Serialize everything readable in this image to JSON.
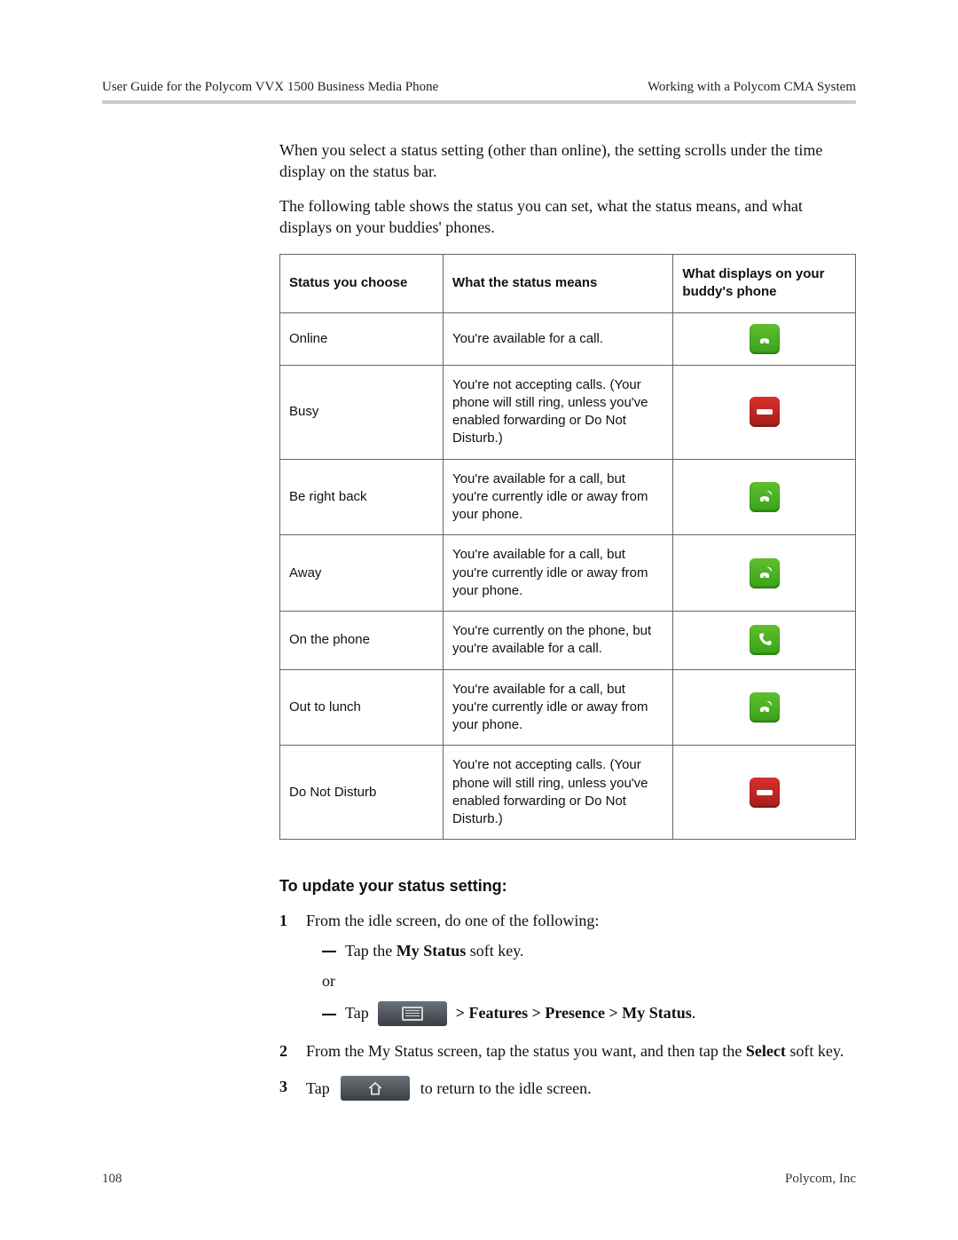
{
  "header": {
    "left": "User Guide for the Polycom VVX 1500 Business Media Phone",
    "right": "Working with a Polycom CMA System"
  },
  "intro": {
    "p1": "When you select a status setting (other than online), the setting scrolls under the time display on the status bar.",
    "p2": "The following table shows the status you can set, what the status means, and what displays on your buddies' phones."
  },
  "table": {
    "headers": {
      "c1": "Status you choose",
      "c2": "What the status means",
      "c3": "What displays on your buddy's phone"
    },
    "rows": [
      {
        "status": "Online",
        "meaning": "You're available for a call.",
        "icon": "online"
      },
      {
        "status": "Busy",
        "meaning": "You're not accepting calls. (Your phone will still ring, unless you've enabled forwarding or Do Not Disturb.)",
        "icon": "busy"
      },
      {
        "status": "Be right back",
        "meaning": "You're available for a call, but you're currently idle or away from your phone.",
        "icon": "away"
      },
      {
        "status": "Away",
        "meaning": "You're available for a call, but you're currently idle or away from your phone.",
        "icon": "away"
      },
      {
        "status": "On the phone",
        "meaning": "You're currently on the phone, but you're available for a call.",
        "icon": "onphone"
      },
      {
        "status": "Out to lunch",
        "meaning": "You're available for a call, but you're currently idle or away from your phone.",
        "icon": "away"
      },
      {
        "status": "Do Not Disturb",
        "meaning": "You're not accepting calls. (Your phone will still ring, unless you've enabled forwarding or Do Not Disturb.)",
        "icon": "busy"
      }
    ]
  },
  "section": {
    "heading": "To update your status setting:",
    "step1_text": "From the idle screen, do one of the following:",
    "step1_bullet1_a": "Tap the ",
    "step1_bullet1_b": "My Status",
    "step1_bullet1_c": " soft key.",
    "step1_or": "or",
    "step1_bullet2_a": "Tap",
    "step1_bullet2_b": "> Features > Presence > My Status",
    "step1_bullet2_c": ".",
    "step2_a": "From the My Status screen, tap the status you want, and then tap the ",
    "step2_b": "Select",
    "step2_c": " soft key.",
    "step3_a": "Tap",
    "step3_b": "to return to the idle screen."
  },
  "footer": {
    "left": "108",
    "right": "Polycom, Inc"
  }
}
